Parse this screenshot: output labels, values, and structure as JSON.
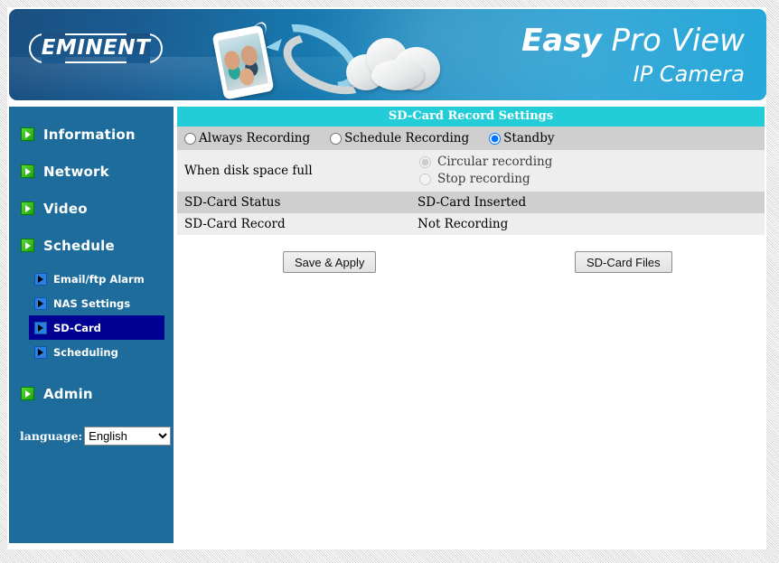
{
  "banner": {
    "logo_text": "EMINENT",
    "brand_line1_bold": "Easy",
    "brand_line1_rest": " Pro View",
    "brand_line2": "IP Camera",
    "icons": {
      "wifi": "wifi-signal-icon",
      "tablet": "tablet-device-icon",
      "cloud": "cloud-icon",
      "arrow_to_cloud": "arrow-upload-icon",
      "arrow_from_cloud": "arrow-download-icon"
    },
    "colors": {
      "blue_dark": "#1b4f80",
      "blue_light": "#27a9da"
    }
  },
  "sidebar": {
    "bg_color": "#1e6c9b",
    "active_color": "#000092",
    "items": [
      {
        "label": "Information",
        "icon": "play-green-icon"
      },
      {
        "label": "Network",
        "icon": "play-green-icon"
      },
      {
        "label": "Video",
        "icon": "play-green-icon"
      },
      {
        "label": "Schedule",
        "icon": "play-green-icon"
      }
    ],
    "sub_items": [
      {
        "label": "Email/ftp Alarm",
        "icon": "play-blue-icon",
        "active": false
      },
      {
        "label": "NAS Settings",
        "icon": "play-blue-icon",
        "active": false
      },
      {
        "label": "SD-Card",
        "icon": "play-blue-icon",
        "active": true
      },
      {
        "label": "Scheduling",
        "icon": "play-blue-icon",
        "active": false
      }
    ],
    "admin": {
      "label": "Admin",
      "icon": "play-green-icon"
    },
    "language": {
      "label": "language:",
      "selected": "English",
      "options": [
        "English"
      ]
    }
  },
  "main": {
    "panel_title": "SD-Card Record Settings",
    "panel_title_color": "#22cdd8",
    "record_mode": {
      "selected": "Standby",
      "options": [
        {
          "label": "Always Recording",
          "checked": false
        },
        {
          "label": "Schedule Recording",
          "checked": false
        },
        {
          "label": "Standby",
          "checked": true
        }
      ]
    },
    "rows": [
      {
        "key": "When disk space full",
        "type": "radios",
        "options": [
          {
            "label": "Circular recording",
            "checked": true
          },
          {
            "label": "Stop recording",
            "checked": false
          }
        ]
      },
      {
        "key": "SD-Card Status",
        "type": "text",
        "value": "SD-Card Inserted"
      },
      {
        "key": "SD-Card Record",
        "type": "text",
        "value": "Not Recording"
      }
    ],
    "buttons": {
      "save": "Save & Apply",
      "files": "SD-Card Files"
    }
  }
}
